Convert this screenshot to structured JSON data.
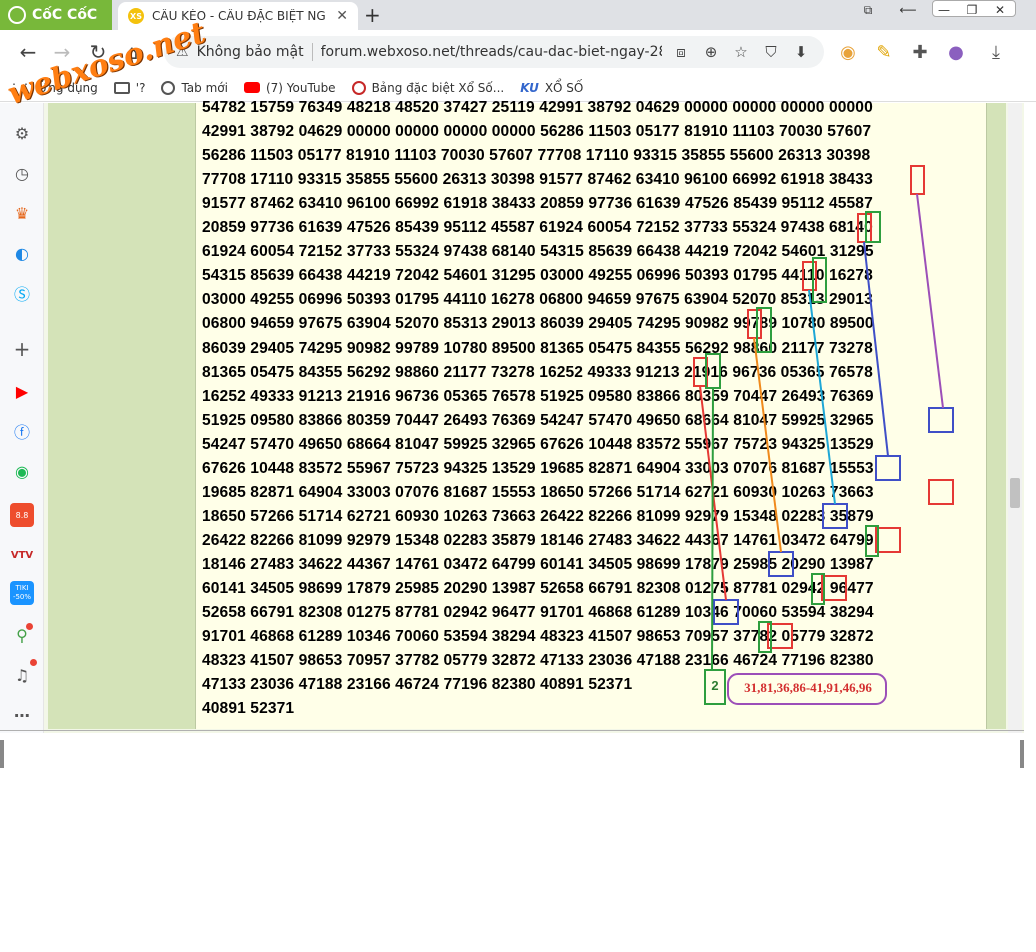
{
  "browser": {
    "brand": "CốC CốC",
    "tab": {
      "favicon": "XS",
      "title": "CẦU KÈO - CẦU ĐẶC BIỆT NG"
    },
    "new_tab": "+",
    "address": {
      "security": "Không bảo mật",
      "url": "forum.webxoso.net/threads/cau-dac-biet-ngay-28-..."
    },
    "nav": {
      "back": "←",
      "forward": "→"
    },
    "window": {
      "minimize": "—",
      "restore": "❐",
      "close": "✕",
      "cast": "⧉",
      "pin": "⟵"
    }
  },
  "bookmarks": [
    {
      "label": "Ứng dụng",
      "icon": "apps-icon"
    },
    {
      "label": "'?",
      "icon": "folder-icon"
    },
    {
      "label": "Tab mới",
      "icon": "globe-icon"
    },
    {
      "label": "(7) YouTube",
      "icon": "youtube-icon"
    },
    {
      "label": "Bảng đặc biệt Xổ Số...",
      "icon": "xoso-icon"
    },
    {
      "label": "XỔ SỐ",
      "icon": "ku-icon",
      "prefix": "KU"
    }
  ],
  "watermark": "webxoso.net",
  "sidebar_icons": [
    "settings-icon",
    "history-icon",
    "crown-icon",
    "messenger-icon",
    "skype-icon",
    "add-icon",
    "youtube-icon",
    "facebook-icon",
    "spotify-icon",
    "shopee-icon",
    "vtv-icon",
    "tiki-icon",
    "vpn-icon",
    "bell-icon",
    "more-icon"
  ],
  "sidebar_labels": {
    "shopee": "8.8",
    "tiki": "TIKI -50%"
  },
  "number_lines": [
    "54782 15759 76349 48218 48520 37427 25119 42991 38792 04629 00000 00000 00000 00000",
    "42991 38792 04629 00000 00000 00000 00000 56286 11503 05177 81910 11103 70030 57607",
    "56286 11503 05177 81910 11103 70030 57607 77708 17110 93315 35855 55600 26313 30398",
    "77708 17110 93315 35855 55600 26313 30398 91577 87462 63410 96100 66992 61918 38433",
    "91577 87462 63410 96100 66992 61918 38433 20859 97736 61639 47526 85439 95112 45587",
    "20859 97736 61639 47526 85439 95112 45587 61924 60054 72152 37733 55324 97438 68140",
    "61924 60054 72152 37733 55324 97438 68140 54315 85639 66438 44219 72042 54601 31295",
    "54315 85639 66438 44219 72042 54601 31295 03000 49255 06996 50393 01795 44110 16278",
    "03000 49255 06996 50393 01795 44110 16278 06800 94659 97675 63904 52070 85313 29013",
    "06800 94659 97675 63904 52070 85313 29013 86039 29405 74295 90982 99789 10780 89500",
    "86039 29405 74295 90982 99789 10780 89500 81365 05475 84355 56292 98860 21177 73278",
    "81365 05475 84355 56292 98860 21177 73278 16252 49333 91213 21916 96736 05365 76578",
    "16252 49333 91213 21916 96736 05365 76578 51925 09580 83866 80359 70447 26493 76369",
    "51925 09580 83866 80359 70447 26493 76369 54247 57470 49650 68664 81047 59925 32965",
    "54247 57470 49650 68664 81047 59925 32965 67626 10448 83572 55967 75723 94325 13529",
    "67626 10448 83572 55967 75723 94325 13529 19685 82871 64904 33003 07076 81687 15553",
    "19685 82871 64904 33003 07076 81687 15553 18650 57266 51714 62721 60930 10263 73663",
    "18650 57266 51714 62721 60930 10263 73663 26422 82266 81099 92979 15348 02283 35879",
    "26422 82266 81099 92979 15348 02283 35879 18146 27483 34622 44367 14761 03472 64799",
    "18146 27483 34622 44367 14761 03472 64799 60141 34505 98699 17879 25985 20290 13987",
    "60141 34505 98699 17879 25985 20290 13987 52658 66791 82308 01275 87781 02942 96477",
    "52658 66791 82308 01275 87781 02942 96477 91701 46868 61289 10346 70060 53594 38294",
    "91701 46868 61289 10346 70060 53594 38294 48323 41507 98653 70957 37782 05779 32872",
    "48323 41507 98653 70957 37782 05779 32872 47133 23036 47188 23166 46724 77196 82380",
    "47133 23036 47188 23166 46724 77196 82380 40891 52371",
    "40891 52371"
  ],
  "annotation": {
    "count": "2",
    "result": "31,81,36,86-41,91,46,96"
  },
  "colors": {
    "red": "#e53935",
    "green": "#2e9e3e",
    "blue": "#3f4fc7",
    "purple": "#9c4fb8",
    "orange": "#f08a1c",
    "cyan": "#1ea7d6",
    "darkred": "#c62828"
  }
}
